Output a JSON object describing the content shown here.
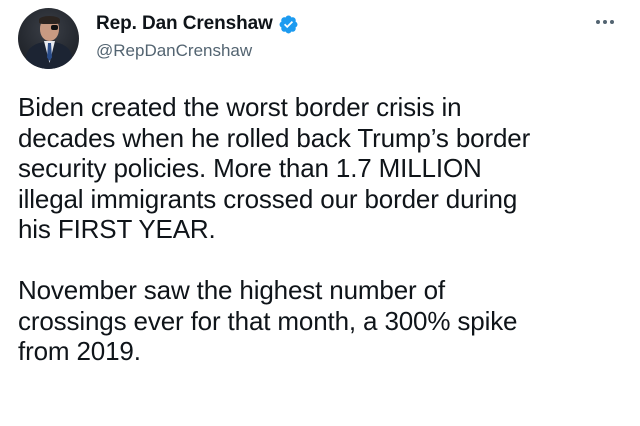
{
  "author": {
    "display_name": "Rep. Dan Crenshaw",
    "handle": "@RepDanCrenshaw",
    "verified": true,
    "verified_color": "#1d9bf0"
  },
  "tweet": {
    "paragraphs": [
      [
        "Biden created the worst border crisis in",
        "decades when he rolled back Trump’s border",
        "security policies. More than 1.7 MILLION",
        "illegal immigrants crossed our border during",
        "his FIRST YEAR."
      ],
      [
        "November saw the highest number of",
        "crossings ever for that month, a 300% spike",
        "from 2019."
      ]
    ]
  },
  "icons": {
    "avatar": "avatar-photo",
    "verified": "verified-badge-icon",
    "more": "more-options-icon"
  },
  "colors": {
    "text_primary": "#0f1419",
    "text_secondary": "#536471",
    "background": "#ffffff"
  }
}
